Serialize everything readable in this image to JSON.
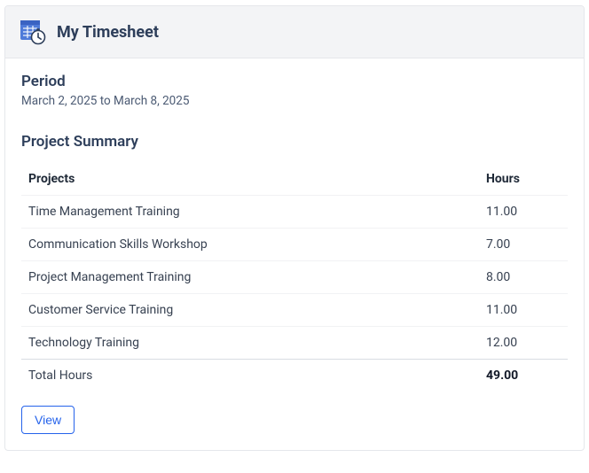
{
  "header": {
    "title": "My Timesheet"
  },
  "period": {
    "label": "Period",
    "text": "March 2, 2025 to March 8, 2025"
  },
  "summary": {
    "title": "Project Summary",
    "columns": {
      "projects": "Projects",
      "hours": "Hours"
    },
    "rows": [
      {
        "project": "Time Management Training",
        "hours": "11.00"
      },
      {
        "project": "Communication Skills Workshop",
        "hours": "7.00"
      },
      {
        "project": "Project Management Training",
        "hours": "8.00"
      },
      {
        "project": "Customer Service Training",
        "hours": "11.00"
      },
      {
        "project": "Technology Training",
        "hours": "12.00"
      }
    ],
    "total": {
      "label": "Total Hours",
      "hours": "49.00"
    }
  },
  "actions": {
    "view_label": "View"
  }
}
